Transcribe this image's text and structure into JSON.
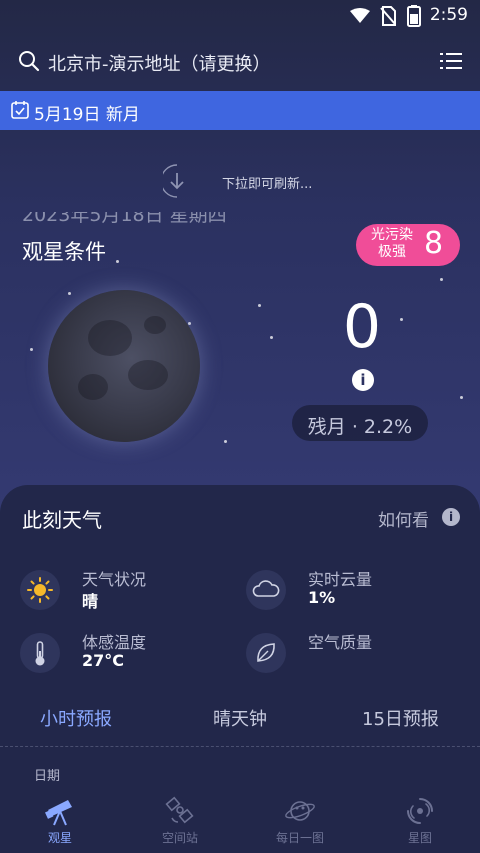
{
  "status_bar": {
    "time": "2:59"
  },
  "header": {
    "location": "北京市-演示地址（请更换）"
  },
  "date_banner": {
    "text": "5月19日 新月"
  },
  "refresh": {
    "hint": "下拉即可刷新..."
  },
  "observation": {
    "date": "2023年5月18日 星期四",
    "title": "观星条件",
    "light_pollution_label_line1": "光污染",
    "light_pollution_label_line2": "极强",
    "light_pollution_value": "8",
    "score": "0",
    "moon_phase": "残月 · 2.2%"
  },
  "weather": {
    "title": "此刻天气",
    "how_to_read": "如何看",
    "items": [
      {
        "label": "天气状况",
        "value": "晴",
        "icon": "sun-icon"
      },
      {
        "label": "实时云量",
        "value": "1%",
        "icon": "cloud-icon"
      },
      {
        "label": "体感温度",
        "value": "27°C",
        "icon": "thermometer-icon"
      },
      {
        "label": "空气质量",
        "value": "",
        "icon": "leaf-icon"
      }
    ]
  },
  "tabs": [
    {
      "label": "小时预报",
      "active": true
    },
    {
      "label": "晴天钟",
      "active": false
    },
    {
      "label": "15日预报",
      "active": false
    }
  ],
  "table": {
    "date_header": "日期"
  },
  "bottom_nav": [
    {
      "label": "观星",
      "icon": "telescope-icon",
      "active": true
    },
    {
      "label": "空间站",
      "icon": "satellite-icon",
      "active": false
    },
    {
      "label": "每日一图",
      "icon": "planet-icon",
      "active": false
    },
    {
      "label": "星图",
      "icon": "galaxy-icon",
      "active": false
    }
  ],
  "colors": {
    "background": "#262c4f",
    "banner": "#3f66e0",
    "light_pollution_badge": "#f04d98",
    "accent": "#8aa8ff",
    "sun": "#f5b82a"
  }
}
